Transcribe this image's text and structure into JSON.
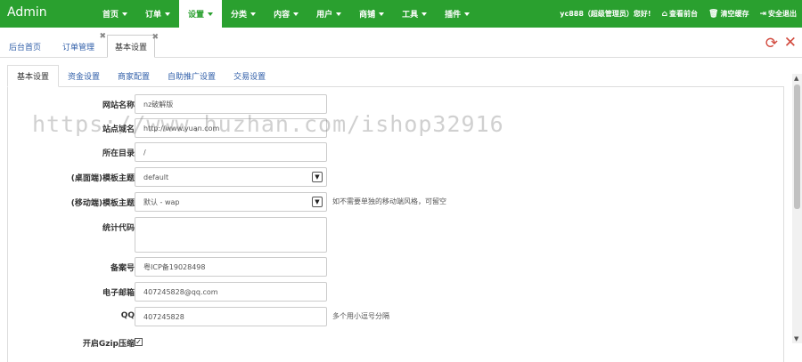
{
  "topbar": {
    "brand": "Admin",
    "nav": [
      {
        "label": "首页",
        "active": false
      },
      {
        "label": "订单",
        "active": false
      },
      {
        "label": "设置",
        "active": true
      },
      {
        "label": "分类",
        "active": false
      },
      {
        "label": "内容",
        "active": false
      },
      {
        "label": "用户",
        "active": false
      },
      {
        "label": "商铺",
        "active": false
      },
      {
        "label": "工具",
        "active": false
      },
      {
        "label": "插件",
        "active": false
      }
    ],
    "user_greeting": "yc888（超级管理员）您好!",
    "view_front": "查看前台",
    "clear_cache": "清空缓存",
    "logout": "安全退出"
  },
  "page_tabs": [
    {
      "label": "后台首页",
      "closable": false,
      "active": false
    },
    {
      "label": "订单管理",
      "closable": true,
      "active": false
    },
    {
      "label": "基本设置",
      "closable": true,
      "active": true
    }
  ],
  "sub_tabs": [
    "基本设置",
    "资金设置",
    "商家配置",
    "自助推广设置",
    "交易设置"
  ],
  "form": {
    "site_name": {
      "label": "网站名称",
      "value": "nz破解版"
    },
    "site_domain": {
      "label": "站点域名",
      "value": "http://www.yuan.com"
    },
    "directory": {
      "label": "所在目录",
      "value": "/"
    },
    "pc_theme": {
      "label": "(桌面端)模板主题",
      "value": "default"
    },
    "mobile_theme": {
      "label": "(移动端)模板主题",
      "value": "默认 - wap",
      "hint": "如不需要单独的移动端风格，可留空"
    },
    "stats_code": {
      "label": "统计代码",
      "value": ""
    },
    "icp": {
      "label": "备案号",
      "value": "粤ICP备19028498"
    },
    "email": {
      "label": "电子邮箱",
      "value": "407245828@qq.com"
    },
    "qq": {
      "label": "QQ",
      "value": "407245828",
      "hint": "多个用小逗号分隔"
    },
    "gzip": {
      "label": "开启Gzip压缩",
      "checked": true
    }
  },
  "watermark": "https://www.huzhan.com/ishop32916"
}
